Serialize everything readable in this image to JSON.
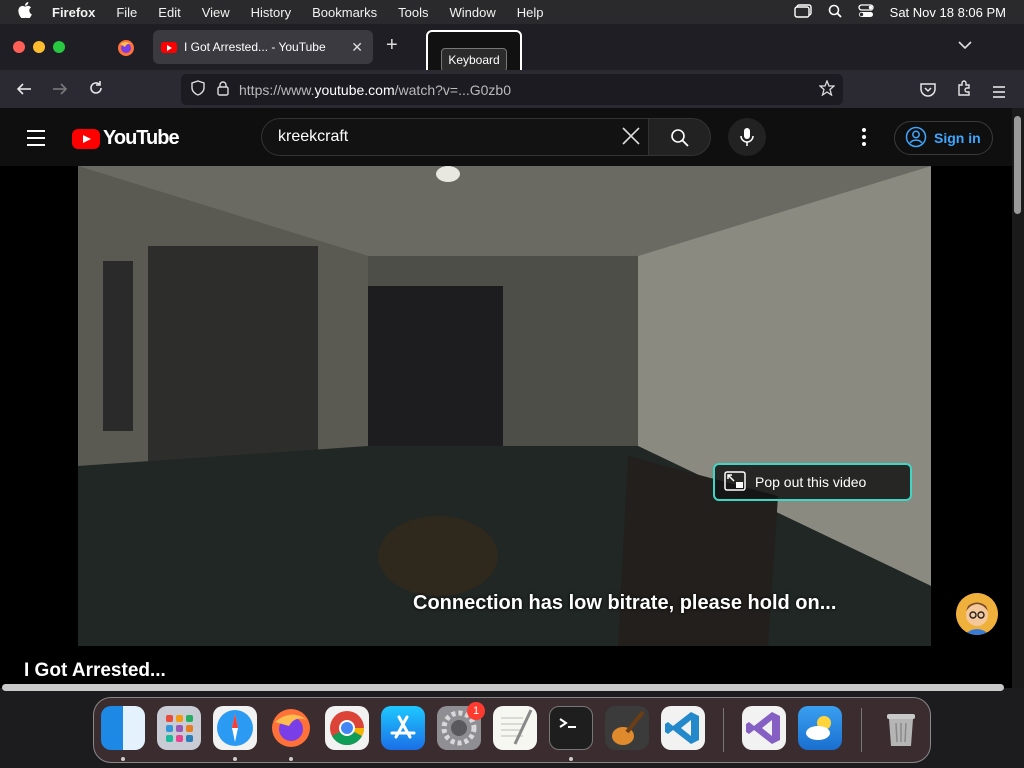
{
  "menubar": {
    "apple_icon": "apple-logo",
    "items": [
      "Firefox",
      "File",
      "Edit",
      "View",
      "History",
      "Bookmarks",
      "Tools",
      "Window",
      "Help"
    ],
    "datetime": "Sat Nov 18  8:06 PM"
  },
  "browser": {
    "active_tab_title": "I Got Arrested... - YouTube",
    "tooltip": "Keyboard",
    "url_prefix": "https://www.",
    "url_domain": "youtube.com",
    "url_rest": "/watch?v=...G0zb0"
  },
  "youtube": {
    "logo_text": "YouTube",
    "search_value": "kreekcraft",
    "sign_in": "Sign in",
    "popout_label": "Pop out this video",
    "bitrate_message": "Connection has low bitrate, please hold on...",
    "video_title": "I Got Arrested..."
  },
  "dock": {
    "apps": [
      "finder",
      "launchpad",
      "safari",
      "firefox",
      "chrome",
      "app-store",
      "system-settings",
      "textedit",
      "terminal",
      "garageband",
      "vscode",
      "visual-studio",
      "weather",
      "trash"
    ],
    "system_settings_badge": "1"
  },
  "colors": {
    "accent_link": "#3ea6ff",
    "yt_red": "#ff0000",
    "popout_border": "#3fd6c6"
  }
}
